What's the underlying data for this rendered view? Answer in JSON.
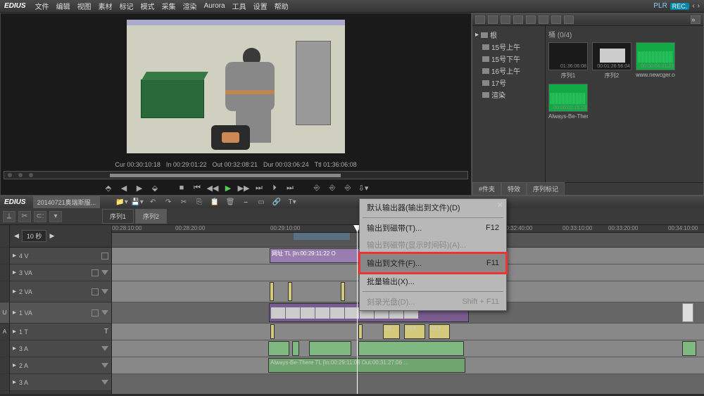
{
  "app": {
    "name": "EDIUS",
    "pla": "PLR",
    "rec": "REC."
  },
  "menu": [
    "文件",
    "编辑",
    "视图",
    "素材",
    "标记",
    "模式",
    "采集",
    "渲染",
    "Aurora",
    "工具",
    "设置",
    "帮助"
  ],
  "preview": {
    "cur": "Cur 00:30:10:18",
    "in": "In 00:29:01:22",
    "out": "Out 00:32:08:21",
    "dur": "Dur 00:03:06:24",
    "ttl": "Ttl 01:36:06:08"
  },
  "bin": {
    "root": "根",
    "folders": [
      "15号上午",
      "15号下午",
      "16号上午",
      "17号",
      "渲染"
    ],
    "header": "桶 (0/4)",
    "clips": [
      {
        "name": "序列1",
        "tc": "01:36:06:08",
        "kind": "seq"
      },
      {
        "name": "序列2",
        "tc": "00:01:26:56:04",
        "kind": "car"
      },
      {
        "name": "www.newcger.com",
        "tc": "00:00:04:01:23",
        "kind": "wave"
      },
      {
        "name": "Always-Be-There",
        "tc": "00:00:02:15:23",
        "kind": "wave"
      }
    ]
  },
  "side_tabs": [
    "#件夹",
    "特效",
    "序列标记"
  ],
  "timeline": {
    "project": "20140721奥瑞斯服...",
    "seq_tabs": [
      "序列1",
      "序列2"
    ],
    "secs": "10 秒",
    "ruler": [
      "00:28:10:00",
      "00:28:20:00",
      "",
      "00:29:10:00",
      "",
      "",
      "",
      "00:32:40:00",
      "00:33:10:00",
      "00:33:20:00",
      "",
      "00:34:10:00"
    ],
    "tracks": [
      "4 V",
      "3 VA",
      "2 VA",
      "1 VA",
      "1 T",
      "3 A",
      "2 A",
      "3 A"
    ],
    "url_clip": "网址  TL [In:00:29:11:22 O",
    "main_clip": "",
    "t_clips": [
      "01...",
      "012...",
      "012..."
    ],
    "audio_label": "Always-Be-There  TL [In:00:29:11:08 Out:00:31:27:06 ..."
  },
  "context_menu": {
    "items": [
      {
        "label": "默认输出器(输出到文件)(D)",
        "key": "",
        "dis": false
      },
      {
        "label": "输出到磁带(T)...",
        "key": "F12",
        "dis": false
      },
      {
        "label": "输出到磁带(显示时间码)(A)...",
        "key": "",
        "dis": true
      },
      {
        "label": "输出到文件(F)...",
        "key": "F11",
        "dis": false,
        "hl": true
      },
      {
        "label": "批量输出(X)...",
        "key": "",
        "dis": false
      },
      {
        "label": "刻录光盘(D)...",
        "key": "Shift + F11",
        "dis": true
      }
    ]
  }
}
